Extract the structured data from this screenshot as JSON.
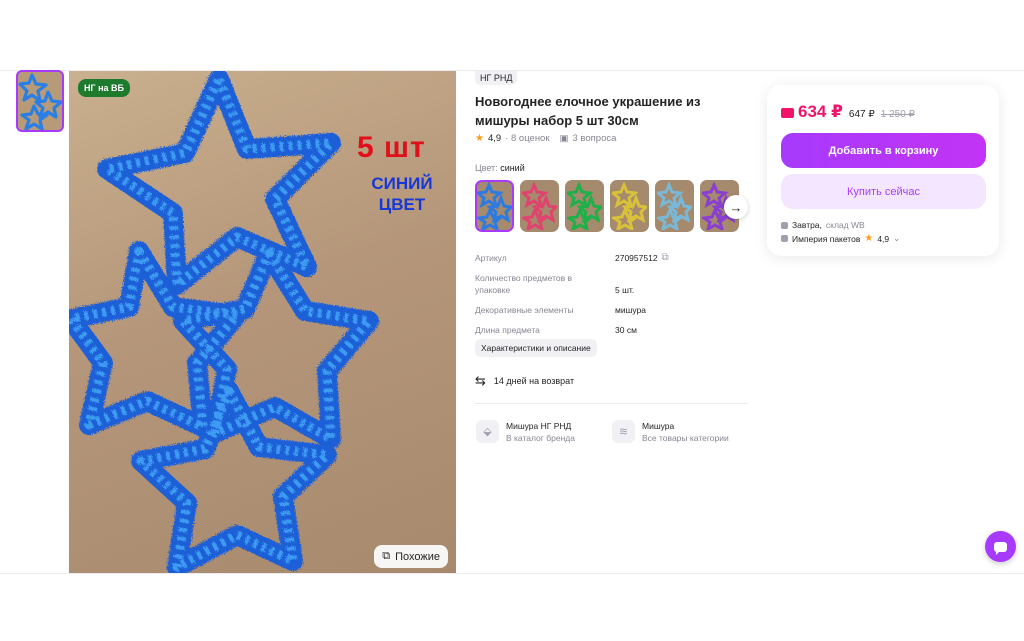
{
  "gallery": {
    "badge": "НГ на ВБ",
    "overlay_count": "5 шт",
    "overlay_color_line1": "СИНИЙ",
    "overlay_color_line2": "ЦВЕТ",
    "similar_label": "Похожие"
  },
  "product": {
    "brand_tag": "НГ РНД",
    "title": "Новогоднее елочное украшение из мишуры набор 5 шт 30см",
    "rating": "4,9",
    "reviews": "· 8 оценок",
    "questions": "3 вопроса",
    "color_label": "Цвет:",
    "color_value": "синий",
    "variants": [
      {
        "color": "#2d7be0"
      },
      {
        "color": "#e0446e"
      },
      {
        "color": "#1fb04a"
      },
      {
        "color": "#d9c23a"
      },
      {
        "color": "#7ab8d8"
      },
      {
        "color": "#8a3fd0"
      }
    ]
  },
  "specs": [
    {
      "name": "Артикул",
      "value": "270957512"
    },
    {
      "name": "Количество предметов в упаковке",
      "value": "5 шт."
    },
    {
      "name": "Декоративные элементы",
      "value": "мишура"
    },
    {
      "name": "Длина предмета",
      "value": "30 см"
    }
  ],
  "chars_button": "Характеристики и описание",
  "return_text": "14 дней на возврат",
  "brand_links": [
    {
      "title": "Мишура НГ РНД",
      "subtitle": "В каталог бренда"
    },
    {
      "title": "Мишура",
      "subtitle": "Все товары категории"
    }
  ],
  "price_card": {
    "price": "634 ₽",
    "price_wb": "647 ₽",
    "price_old": "1 250 ₽",
    "add_to_cart": "Добавить в корзину",
    "buy_now": "Купить сейчас",
    "delivery_day": "Завтра,",
    "delivery_warehouse": "склад WB",
    "seller": "Империя пакетов",
    "seller_rating": "4,9"
  },
  "colors": {
    "accent": "#a73afd",
    "price": "#f0126b",
    "tinsel": "#1f6fe0"
  }
}
